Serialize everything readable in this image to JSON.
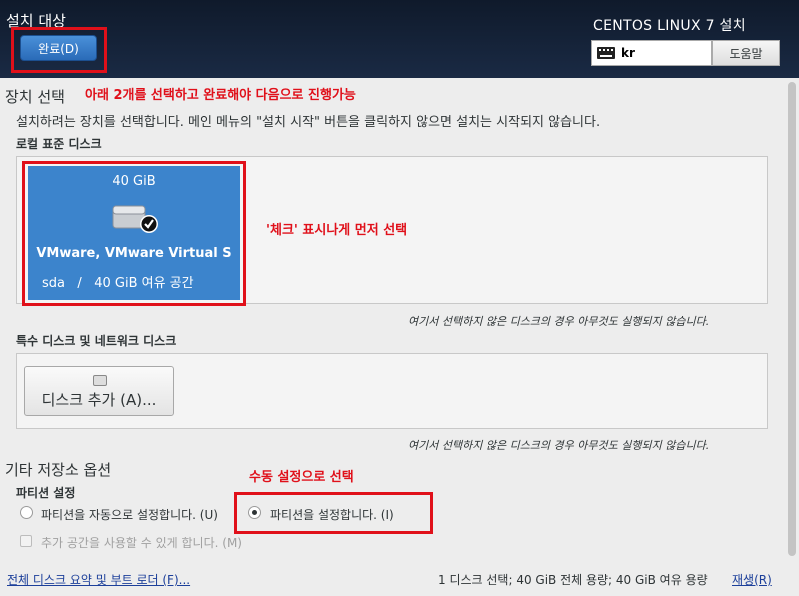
{
  "header": {
    "title": "설치 대상",
    "done_label": "완료(D)",
    "product": "CENTOS LINUX 7 설치",
    "keyboard_layout": "kr",
    "help_label": "도움말"
  },
  "device_selection": {
    "title": "장치 선택",
    "annotation": "아래 2개를 선택하고 완료해야 다음으로 진행가능",
    "description": "설치하려는 장치를 선택합니다. 메인 메뉴의 \"설치 시작\" 버튼을 클릭하지 않으면 설치는 시작되지 않습니다.",
    "local_disks_label": "로컬 표준 디스크",
    "disk": {
      "size": "40 GiB",
      "name": "VMware, VMware Virtual S",
      "device": "sda",
      "separator": "/",
      "free": "40 GiB 여유 공간"
    },
    "disk_annotation": "'체크' 표시나게 먼저 선택",
    "local_note": "여기서 선택하지 않은 디스크의 경우 아무것도 실행되지 않습니다.",
    "special_disks_label": "특수 디스크 및 네트워크 디스크",
    "add_disk_label": "디스크 추가 (A)...",
    "special_note": "여기서 선택하지 않은 디스크의 경우 아무것도 실행되지 않습니다."
  },
  "other_options": {
    "title": "기타 저장소 옵션",
    "partition_label": "파티션 설정",
    "auto_label": "파티션을 자동으로 설정합니다. (U)",
    "manual_label": "파티션을 설정합니다. (I)",
    "manual_annotation": "수동 설정으로 선택",
    "extra_space_label": "추가 공간을 사용할 수 있게 합니다. (M)"
  },
  "footer": {
    "summary_link": "전체 디스크 요약 및 부트 로더 (F)...",
    "status": "1 디스크 선택; 40 GiB 전체 용량; 40 GiB 여유 용량",
    "rescan_label": "재생(R)"
  },
  "colors": {
    "accent": "#3c84cc",
    "annotation_red": "#e0101a",
    "header_bg": "#0f1a2b"
  }
}
